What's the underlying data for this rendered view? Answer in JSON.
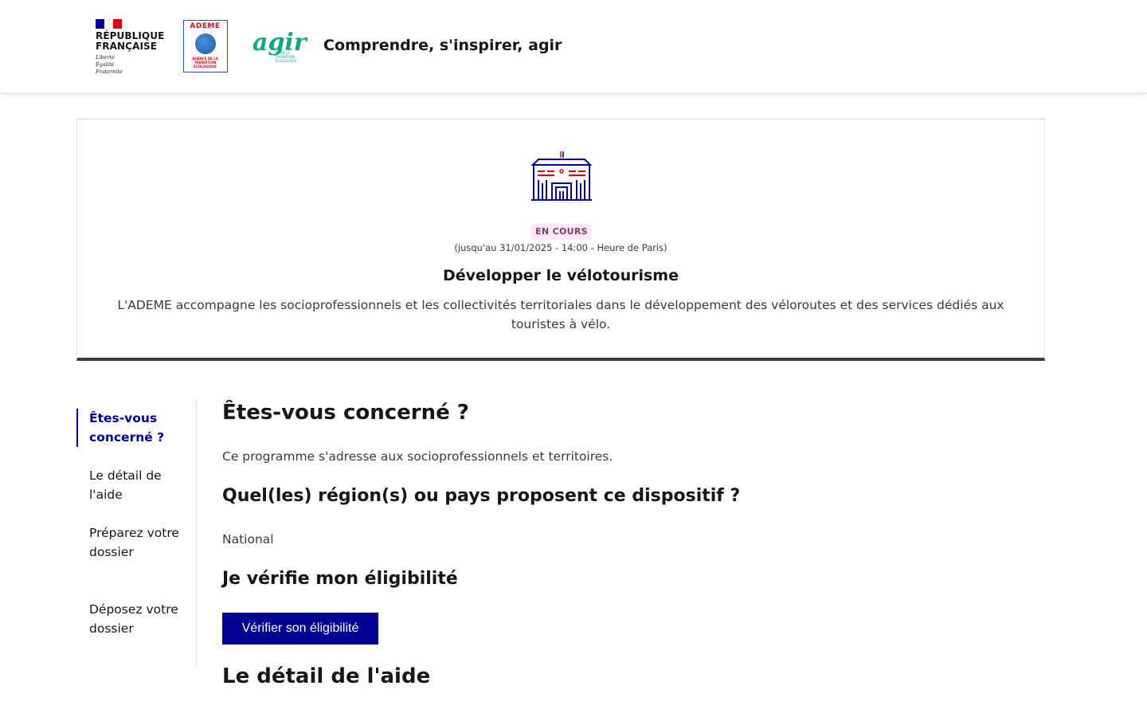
{
  "header": {
    "rf": {
      "name_line1": "RÉPUBLIQUE",
      "name_line2": "FRANÇAISE",
      "motto1": "Liberté",
      "motto2": "Égalité",
      "motto3": "Fraternité",
      "flag_colors": [
        "#000091",
        "#ffffff",
        "#e1000f"
      ]
    },
    "ademe": {
      "word": "ADEME",
      "subtitle": "AGENCE DE LA TRANSITION ÉCOLOGIQUE"
    },
    "agir": {
      "word": "agir",
      "subtitle": "POUR LA TRANSITION ÉCOLOGIQUE"
    },
    "site_title": "Comprendre, s'inspirer, agir"
  },
  "hero": {
    "icon": "building-icon",
    "status_badge": "EN COURS",
    "deadline": "(jusqu'au 31/01/2025 - 14:00 - Heure de Paris)",
    "title": "Développer le vélotourisme",
    "description": "L'ADEME accompagne les socioprofessionnels et les collectivités territoriales dans le développement des véloroutes et des services dédiés aux touristes à vélo."
  },
  "sidemenu": {
    "items": [
      {
        "label": "Êtes-vous concerné ?",
        "active": true
      },
      {
        "label": "Le détail de l'aide",
        "active": false
      },
      {
        "label": "Préparez votre dossier",
        "active": false
      },
      {
        "label": "Déposez votre dossier",
        "active": false
      }
    ]
  },
  "main": {
    "concerned_title": "Êtes-vous concerné ?",
    "concerned_text": "Ce programme s'adresse aux socioprofessionnels et territoires.",
    "regions_title": "Quel(les) région(s) ou pays proposent ce dispositif ?",
    "regions_value": "National",
    "eligibility_title": "Je vérifie mon éligibilité",
    "eligibility_button": "Vérifier son éligibilité",
    "detail_title": "Le détail de l'aide"
  },
  "colors": {
    "primary": "#000091",
    "badge_bg": "#fee7fc",
    "badge_text": "#6e445a",
    "agir_green": "#17a67f",
    "ademe_red": "#e30613"
  }
}
